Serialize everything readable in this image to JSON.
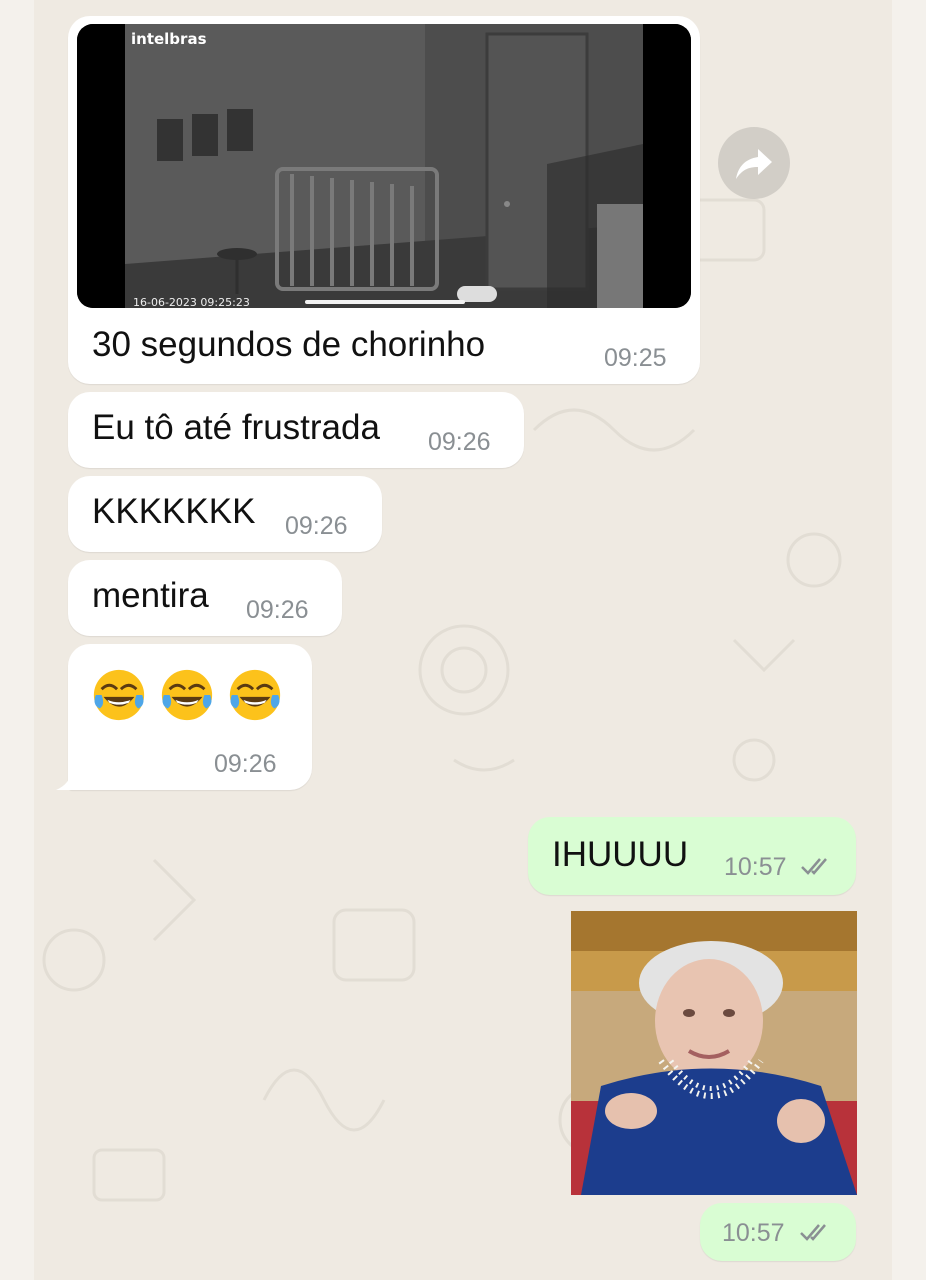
{
  "messages": [
    {
      "id": "m1",
      "direction": "incoming",
      "type": "video",
      "overlay_brand": "intelbras",
      "overlay_timestamp": "16-06-2023 09:25:23",
      "caption": "30 segundos de chorinho",
      "time": "09:25"
    },
    {
      "id": "m2",
      "direction": "incoming",
      "type": "text",
      "text": "Eu tô até frustrada",
      "time": "09:26"
    },
    {
      "id": "m3",
      "direction": "incoming",
      "type": "text",
      "text": "KKKKKKK",
      "time": "09:26"
    },
    {
      "id": "m4",
      "direction": "incoming",
      "type": "text",
      "text": "mentira",
      "time": "09:26"
    },
    {
      "id": "m5",
      "direction": "incoming",
      "type": "emoji",
      "emoji": [
        "face-with-tears-of-joy",
        "face-with-tears-of-joy",
        "face-with-tears-of-joy"
      ],
      "time": "09:26"
    },
    {
      "id": "m6",
      "direction": "outgoing",
      "type": "text",
      "text": "IHUUUU",
      "time": "10:57",
      "status": "read-double-check"
    },
    {
      "id": "m7",
      "direction": "outgoing",
      "type": "gif",
      "time": "10:57",
      "status": "read-double-check"
    }
  ],
  "icons": {
    "forward": "forward-arrow-icon",
    "ticks": "double-check-icon",
    "emoji": "face-with-tears-of-joy"
  },
  "colors": {
    "wallpaper": "#efeae2",
    "incoming_bubble": "#ffffff",
    "outgoing_bubble": "#d9fdd3",
    "time_text": "#8a8f93",
    "tick_gray": "#8a8f93"
  }
}
